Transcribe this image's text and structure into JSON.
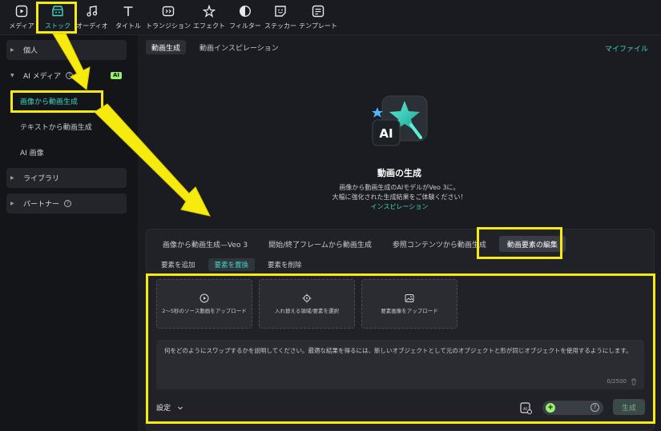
{
  "toolbar": {
    "items": [
      {
        "label": "メディア",
        "icon": "media-icon"
      },
      {
        "label": "ストック",
        "icon": "stock-icon",
        "active": true
      },
      {
        "label": "オーディオ",
        "icon": "audio-icon"
      },
      {
        "label": "タイトル",
        "icon": "title-icon"
      },
      {
        "label": "トランジション",
        "icon": "transition-icon"
      },
      {
        "label": "エフェクト",
        "icon": "effect-icon"
      },
      {
        "label": "フィルター",
        "icon": "filter-icon"
      },
      {
        "label": "ステッカー",
        "icon": "sticker-icon"
      },
      {
        "label": "テンプレート",
        "icon": "template-icon"
      }
    ]
  },
  "sidebar": {
    "personal": "個人",
    "ai_media": "AI メディア",
    "ai_badge": "AI",
    "sub_items": [
      "画像から動画生成",
      "テキストから動画生成",
      "AI 画像"
    ],
    "library": "ライブラリ",
    "partner": "パートナー"
  },
  "main": {
    "top_tabs": [
      "動画生成",
      "動画インスピレーション"
    ],
    "my_files": "マイファイル",
    "hero": {
      "title": "動画の生成",
      "desc_line1": "画像から動画生成のAIモデルがVeo 3に。",
      "desc_line2": "大幅に強化された生成結果をご体験ください！",
      "link": "インスピレーション"
    },
    "mode_tabs": [
      "画像から動画生成—Veo 3",
      "開始/終了フレームから動画生成",
      "参照コンテンツから動画生成",
      "動画要素の編集"
    ],
    "sub_tabs": [
      "要素を追加",
      "要素を置換",
      "要素を削除"
    ],
    "uploads": [
      {
        "label": "2〜5秒のソース動画をアップロード",
        "icon": "video-upload-icon"
      },
      {
        "label": "入れ替える領域/要素を選択",
        "icon": "target-select-icon"
      },
      {
        "label": "要素画像をアップロード",
        "icon": "image-upload-icon"
      }
    ],
    "prompt_placeholder": "何をどのようにスワップするかを説明してください。最適な結果を得るには、新しいオブジェクトとして元のオブジェクトと形が同じオブジェクトを使用するようにします。",
    "counter": "0/2500",
    "settings_label": "設定",
    "generate_label": "生成"
  },
  "colors": {
    "accent": "#3fd6c4",
    "highlight": "#f7ea0e",
    "badge": "#9af06a"
  }
}
